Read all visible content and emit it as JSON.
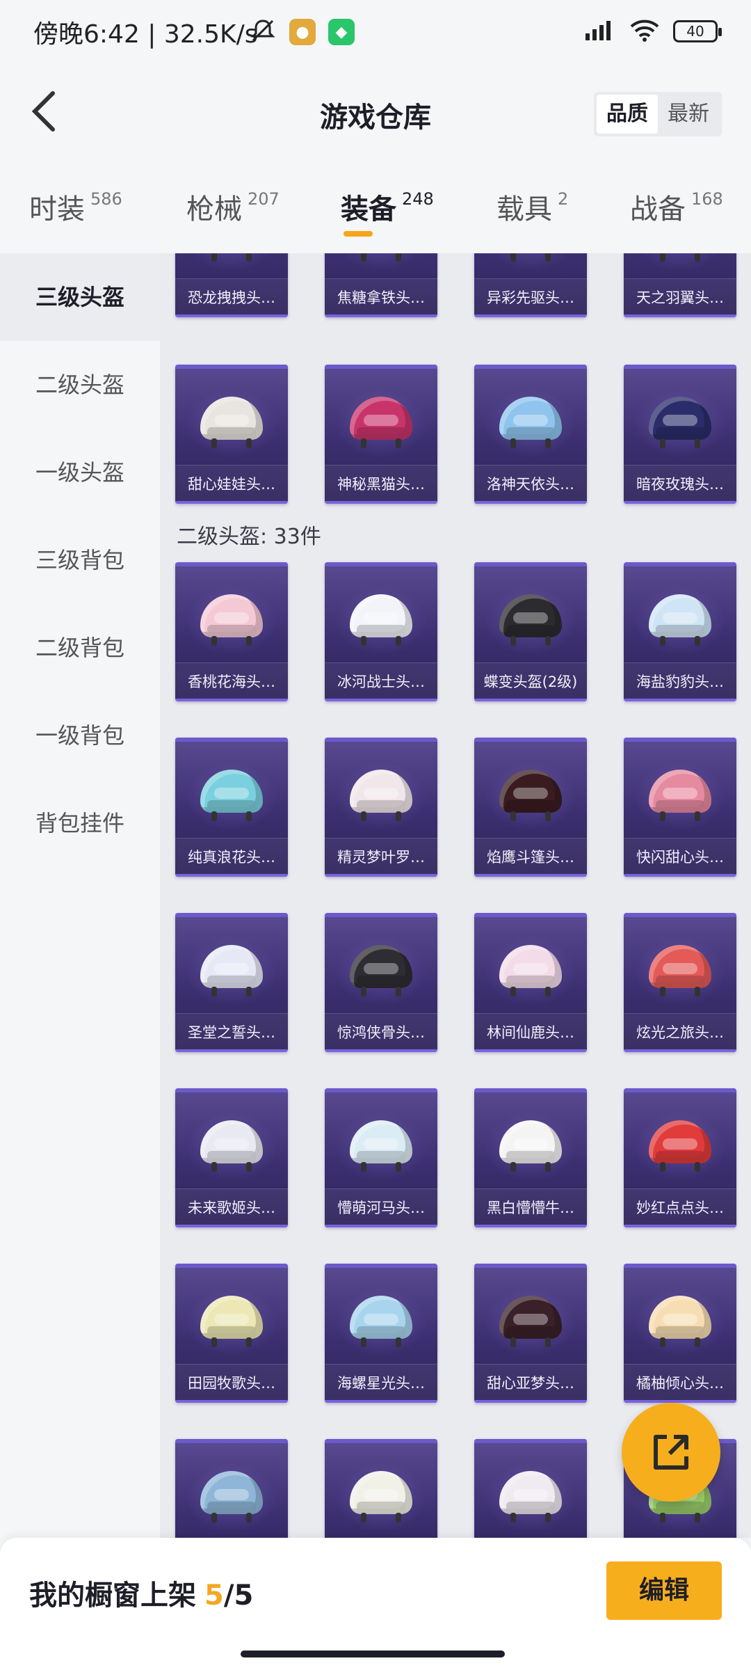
{
  "status_bar": {
    "time": "傍晚6:42 | 32.5K/s",
    "battery": "40"
  },
  "header": {
    "title": "游戏仓库",
    "sort_options": [
      "品质",
      "最新"
    ],
    "selected_sort": "品质"
  },
  "tabs": [
    {
      "label": "时装",
      "count": "586"
    },
    {
      "label": "枪械",
      "count": "207"
    },
    {
      "label": "装备",
      "count": "248"
    },
    {
      "label": "载具",
      "count": "2"
    },
    {
      "label": "战备",
      "count": "168"
    }
  ],
  "active_tab": "装备",
  "sidebar": {
    "items": [
      "三级头盔",
      "二级头盔",
      "一级头盔",
      "三级背包",
      "二级背包",
      "一级背包",
      "背包挂件"
    ],
    "active": "三级头盔"
  },
  "level3_partial_row": [
    "恐龙拽拽头…",
    "焦糖拿铁头…",
    "异彩先驱头…",
    "天之羽翼头…"
  ],
  "level3_row": [
    "甜心娃娃头…",
    "神秘黑猫头…",
    "洛神天依头…",
    "暗夜玫瑰头…"
  ],
  "section_level2": {
    "title": "二级头盔: 33件",
    "items": [
      "香桃花海头…",
      "冰河战士头…",
      "蝶变头盔(2级)",
      "海盐豹豹头…",
      "纯真浪花头…",
      "精灵梦叶罗…",
      "焰鹰斗篷头…",
      "快闪甜心头…",
      "圣堂之誓头…",
      "惊鸿侠骨头…",
      "林间仙鹿头…",
      "炫光之旅头…",
      "未来歌姬头…",
      "懵萌河马头…",
      "黑白懵懵牛…",
      "妙红点点头…",
      "田园牧歌头…",
      "海螺星光头…",
      "甜心亚梦头…",
      "橘柚倾心头…"
    ]
  },
  "helmet_colors": {
    "p0": "#8bbf5a",
    "p1": "#d88c3c",
    "p2": "#b23ca8",
    "p3": "#3c7cc8",
    "a0": "#e8e4df",
    "a1": "#c8346a",
    "a2": "#8ec4ee",
    "a3": "#2a2d6a",
    "b0": "#f4c9d6",
    "b1": "#f2f4fa",
    "b2": "#2b2b30",
    "b3": "#cfe4f4",
    "b4": "#7ad0de",
    "b5": "#f1e6ea",
    "b6": "#3a1c20",
    "b7": "#e68aa0",
    "b8": "#e6e8f6",
    "b9": "#2d2d33",
    "b10": "#f3dce8",
    "b11": "#e35a57",
    "b12": "#e9eaf1",
    "b13": "#dcecf4",
    "b14": "#f4f4f4",
    "b15": "#e23b3b",
    "b16": "#ece7b4",
    "b17": "#a8d4ee",
    "b18": "#3a2028",
    "b19": "#f6ddb3",
    "c0": "#8fb6d8",
    "c1": "#f1f1e8",
    "c2": "#f0eaf1",
    "c3": "#9bd06a"
  },
  "bottom_bar": {
    "label": "我的橱窗上架",
    "current": "5",
    "total": "/5",
    "edit_label": "编辑"
  }
}
